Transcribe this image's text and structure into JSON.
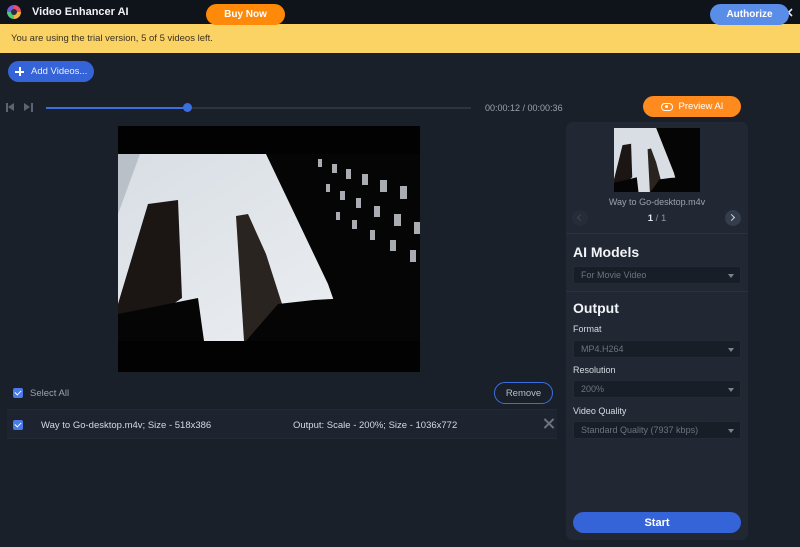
{
  "window": {
    "title": "Video Enhancer AI",
    "controls": [
      "menu",
      "minimize",
      "maximize",
      "close"
    ]
  },
  "banner": {
    "message": "You are using the trial version, 5 of 5 videos left.",
    "buy_label": "Buy Now",
    "authorize_label": "Authorize"
  },
  "toolbar": {
    "add_videos_label": "Add Videos..."
  },
  "player": {
    "current_time": "00:00:12",
    "total_time": "00:00:36",
    "timecode": "00:00:12 / 00:00:36",
    "progress_fraction": 0.333
  },
  "list": {
    "select_all_label": "Select All",
    "select_all_checked": true,
    "remove_label": "Remove",
    "items": [
      {
        "checked": true,
        "name": "Way to Go-desktop.m4v; Size - 518x386",
        "output": "Output: Scale - 200%; Size - 1036x772"
      }
    ]
  },
  "preview": {
    "button_label": "Preview AI",
    "thumb_name": "Way to Go-desktop.m4v",
    "page_current": "1",
    "page_separator": " / ",
    "page_total": "1"
  },
  "settings": {
    "ai_models_title": "AI Models",
    "ai_model_value": "For Movie Video",
    "output_title": "Output",
    "format_label": "Format",
    "format_value": "MP4.H264",
    "resolution_label": "Resolution",
    "resolution_value": "200%",
    "quality_label": "Video Quality",
    "quality_value": "Standard Quality (7937 kbps)",
    "start_label": "Start"
  },
  "colors": {
    "accent_blue": "#3563d8",
    "accent_orange": "#ff8a0a",
    "banner_yellow": "#fbd365",
    "background": "#1a202a",
    "panel": "#212834"
  }
}
